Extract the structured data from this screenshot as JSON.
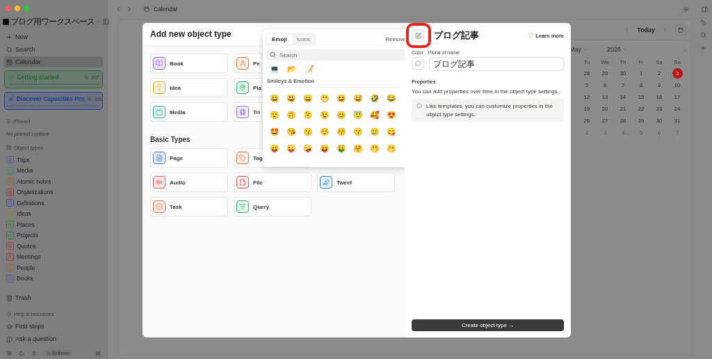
{
  "sidebar": {
    "workspace": "ブログ用ワークスペース",
    "nav": [
      {
        "label": "New",
        "selected": false
      },
      {
        "label": "Search",
        "selected": false
      },
      {
        "label": "Calendar",
        "selected": true
      }
    ],
    "progress_cards": [
      {
        "title": "Getting started",
        "count": "0/7",
        "level": 0,
        "color": "#1f6b33"
      },
      {
        "title": "Discover Capacities Pro",
        "count": "0/5",
        "level": 0,
        "color": "#1f3f8f"
      }
    ],
    "pinned": {
      "heading": "Pinned",
      "empty": "No pinned content"
    },
    "object_types": {
      "heading": "Object types",
      "items": [
        {
          "label": "Trips",
          "color": "#6d4fb8"
        },
        {
          "label": "Media",
          "color": "#2f8a77"
        },
        {
          "label": "Atomic notes",
          "color": "#9a6a2a"
        },
        {
          "label": "Organizations",
          "color": "#a83a3a"
        },
        {
          "label": "Definitions",
          "color": "#4a4ab0"
        },
        {
          "label": "Ideas",
          "color": "#9a8a20"
        },
        {
          "label": "Places",
          "color": "#2f8a4a"
        },
        {
          "label": "Projects",
          "color": "#2f7a4a"
        },
        {
          "label": "Quotes",
          "color": "#b03a4a"
        },
        {
          "label": "Meetings",
          "color": "#b03a3a"
        },
        {
          "label": "People",
          "color": "#a8622a"
        },
        {
          "label": "Books",
          "color": "#6a4fb8"
        }
      ]
    },
    "trash": "Trash",
    "help": {
      "heading": "Help & resources",
      "items": [
        "First steps",
        "Ask a question"
      ]
    },
    "footer": {
      "badge": "Believer"
    }
  },
  "topbar": {
    "title": "Calendar"
  },
  "calendar": {
    "today": "Today",
    "month": "May",
    "year": "2026",
    "weekdays": [
      "Tu",
      "We",
      "Th",
      "Fr",
      "Sa",
      "Su"
    ],
    "weeks": [
      [
        {
          "day": "28",
          "muted": false,
          "selected": false
        },
        {
          "day": "29",
          "muted": false,
          "selected": false
        },
        {
          "day": "30",
          "muted": false,
          "selected": false
        },
        {
          "day": "1",
          "muted": false,
          "selected": false
        },
        {
          "day": "2",
          "muted": false,
          "selected": false
        },
        {
          "day": "3",
          "muted": false,
          "selected": true
        }
      ],
      [
        {
          "day": "5",
          "muted": false,
          "selected": false
        },
        {
          "day": "6",
          "muted": false,
          "selected": false
        },
        {
          "day": "7",
          "muted": false,
          "selected": false
        },
        {
          "day": "8",
          "muted": false,
          "selected": false
        },
        {
          "day": "9",
          "muted": false,
          "selected": false
        },
        {
          "day": "10",
          "muted": false,
          "selected": false
        }
      ],
      [
        {
          "day": "12",
          "muted": false,
          "selected": false
        },
        {
          "day": "13",
          "muted": false,
          "selected": false
        },
        {
          "day": "14",
          "muted": false,
          "selected": false
        },
        {
          "day": "15",
          "muted": false,
          "selected": false
        },
        {
          "day": "16",
          "muted": false,
          "selected": false
        },
        {
          "day": "17",
          "muted": false,
          "selected": false
        }
      ],
      [
        {
          "day": "19",
          "muted": false,
          "selected": false
        },
        {
          "day": "20",
          "muted": false,
          "selected": false
        },
        {
          "day": "21",
          "muted": false,
          "selected": false
        },
        {
          "day": "22",
          "muted": false,
          "selected": false
        },
        {
          "day": "23",
          "muted": false,
          "selected": false
        },
        {
          "day": "24",
          "muted": false,
          "selected": false
        }
      ],
      [
        {
          "day": "26",
          "muted": false,
          "selected": false
        },
        {
          "day": "27",
          "muted": false,
          "selected": false
        },
        {
          "day": "28",
          "muted": false,
          "selected": false
        },
        {
          "day": "29",
          "muted": false,
          "selected": false
        },
        {
          "day": "30",
          "muted": false,
          "selected": false
        },
        {
          "day": "31",
          "muted": false,
          "selected": false
        }
      ],
      [
        {
          "day": "2",
          "muted": true,
          "selected": false
        },
        {
          "day": "3",
          "muted": true,
          "selected": false
        },
        {
          "day": "4",
          "muted": true,
          "selected": false
        },
        {
          "day": "5",
          "muted": true,
          "selected": false
        },
        {
          "day": "6",
          "muted": true,
          "selected": false
        },
        {
          "day": "7",
          "muted": true,
          "selected": false
        }
      ]
    ]
  },
  "dialog": {
    "title": "Add new object type",
    "featured": [
      [
        {
          "label": "Book",
          "color": "#8b5cf6"
        },
        {
          "label": "Pe",
          "color": "#ea7a3a"
        }
      ],
      [
        {
          "label": "Idea",
          "color": "#d4b020"
        },
        {
          "label": "Pla",
          "color": "#2fb36a"
        }
      ],
      [
        {
          "label": "Media",
          "color": "#2fae95"
        },
        {
          "label": "Tri",
          "color": "#8b6cf6"
        }
      ]
    ],
    "basic_heading": "Basic Types",
    "basic": [
      [
        {
          "label": "Page",
          "color": "#4a7ae0"
        },
        {
          "label": "Tag",
          "color": "#ea7a3a"
        }
      ],
      [
        {
          "label": "Audio",
          "color": "#e05a5a"
        },
        {
          "label": "File",
          "color": "#e05a5a"
        },
        {
          "label": "Tweet",
          "color": "#3a8ae0"
        }
      ],
      [
        {
          "label": "Task",
          "color": "#e0753a"
        },
        {
          "label": "Query",
          "color": "#2fae6a"
        }
      ]
    ]
  },
  "emoji_picker": {
    "tabs": [
      {
        "label": "Emoji",
        "selected": true
      },
      {
        "label": "Icons",
        "selected": false
      }
    ],
    "remove": "Remove",
    "search_placeholder": "Search",
    "recent": [
      "💻",
      "📂",
      "📝"
    ],
    "section": "Smileys & Emotion",
    "emojis": [
      [
        "😀",
        "😃",
        "😄",
        "😁",
        "😆",
        "😅",
        "🤣",
        "😂"
      ],
      [
        "🙂",
        "🙃",
        "🫠",
        "😉",
        "😊",
        "😇",
        "🥰",
        "😍"
      ],
      [
        "🤩",
        "😘",
        "😗",
        "☺️",
        "😚",
        "😙",
        "🥲",
        "😋"
      ],
      [
        "😛",
        "😜",
        "🤪",
        "😝",
        "🤑",
        "🤗",
        "🤭",
        "🫢"
      ]
    ]
  },
  "new_type": {
    "name": "ブログ記事",
    "learn_more": "Learn more",
    "color_label": "Color",
    "plural_label": "Plural of name",
    "plural_value": "ブログ記事",
    "properties_heading": "Properties",
    "properties_text": "You can add properties over time in the object type settings.",
    "tip": "Like templates, you can customize properties in the object type settings.",
    "create": "Create object type →"
  }
}
